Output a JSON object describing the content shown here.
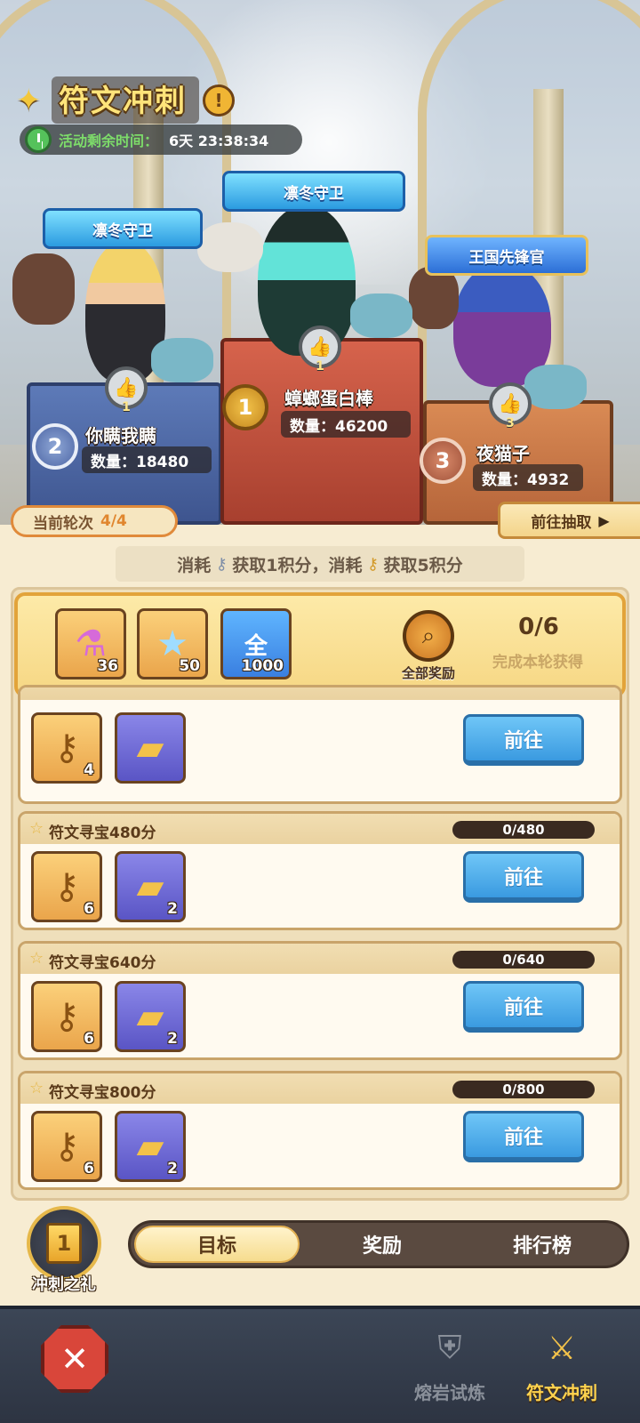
{
  "header": {
    "title": "符文冲刺",
    "timer_label": "活动剩余时间：",
    "timer_value": "6天 23:38:34"
  },
  "podium": [
    {
      "rank": "1",
      "title": "凛冬守卫",
      "likes": "1",
      "name": "蟑螂蛋白棒",
      "qty": "数量：46200"
    },
    {
      "rank": "2",
      "title": "凛冬守卫",
      "likes": "1",
      "name": "你瞒我瞒",
      "qty": "数量：18480"
    },
    {
      "rank": "3",
      "title": "王国先锋官",
      "likes": "3",
      "name": "夜猫子",
      "qty": "数量：4932"
    }
  ],
  "round": {
    "label": "当前轮次",
    "value": "4/4"
  },
  "goto_draw": "前往抽取",
  "hint": {
    "part1": "消耗",
    "part2": "获取1积分，消耗",
    "part3": "获取5积分"
  },
  "round_reward": {
    "items": [
      {
        "icon": "potion-icon",
        "count": "36"
      },
      {
        "icon": "star-crystal-icon",
        "count": "50"
      },
      {
        "icon": "orb-icon",
        "glyph": "全",
        "count": "1000"
      }
    ],
    "all_rewards_label": "全部奖励",
    "progress": "0/6",
    "progress_sub": "完成本轮获得"
  },
  "tasks": [
    {
      "title": "",
      "progress": "",
      "key_count": "4",
      "card_count": "",
      "button": "前往"
    },
    {
      "title": "符文寻宝480分",
      "progress": "0/480",
      "key_count": "6",
      "card_count": "2",
      "button": "前往"
    },
    {
      "title": "符文寻宝640分",
      "progress": "0/640",
      "key_count": "6",
      "card_count": "2",
      "button": "前往"
    },
    {
      "title": "符文寻宝800分",
      "progress": "0/800",
      "key_count": "6",
      "card_count": "2",
      "button": "前往"
    }
  ],
  "gift_label": "冲刺之礼",
  "gift_rank": "1",
  "tabs": [
    "目标",
    "奖励",
    "排行榜"
  ],
  "nav": {
    "lava": "熔岩试炼",
    "rune": "符文冲刺"
  },
  "colors": {
    "accent": "#e08a3a",
    "button_blue": "#3a9ae0",
    "gold": "#ffd34e"
  }
}
